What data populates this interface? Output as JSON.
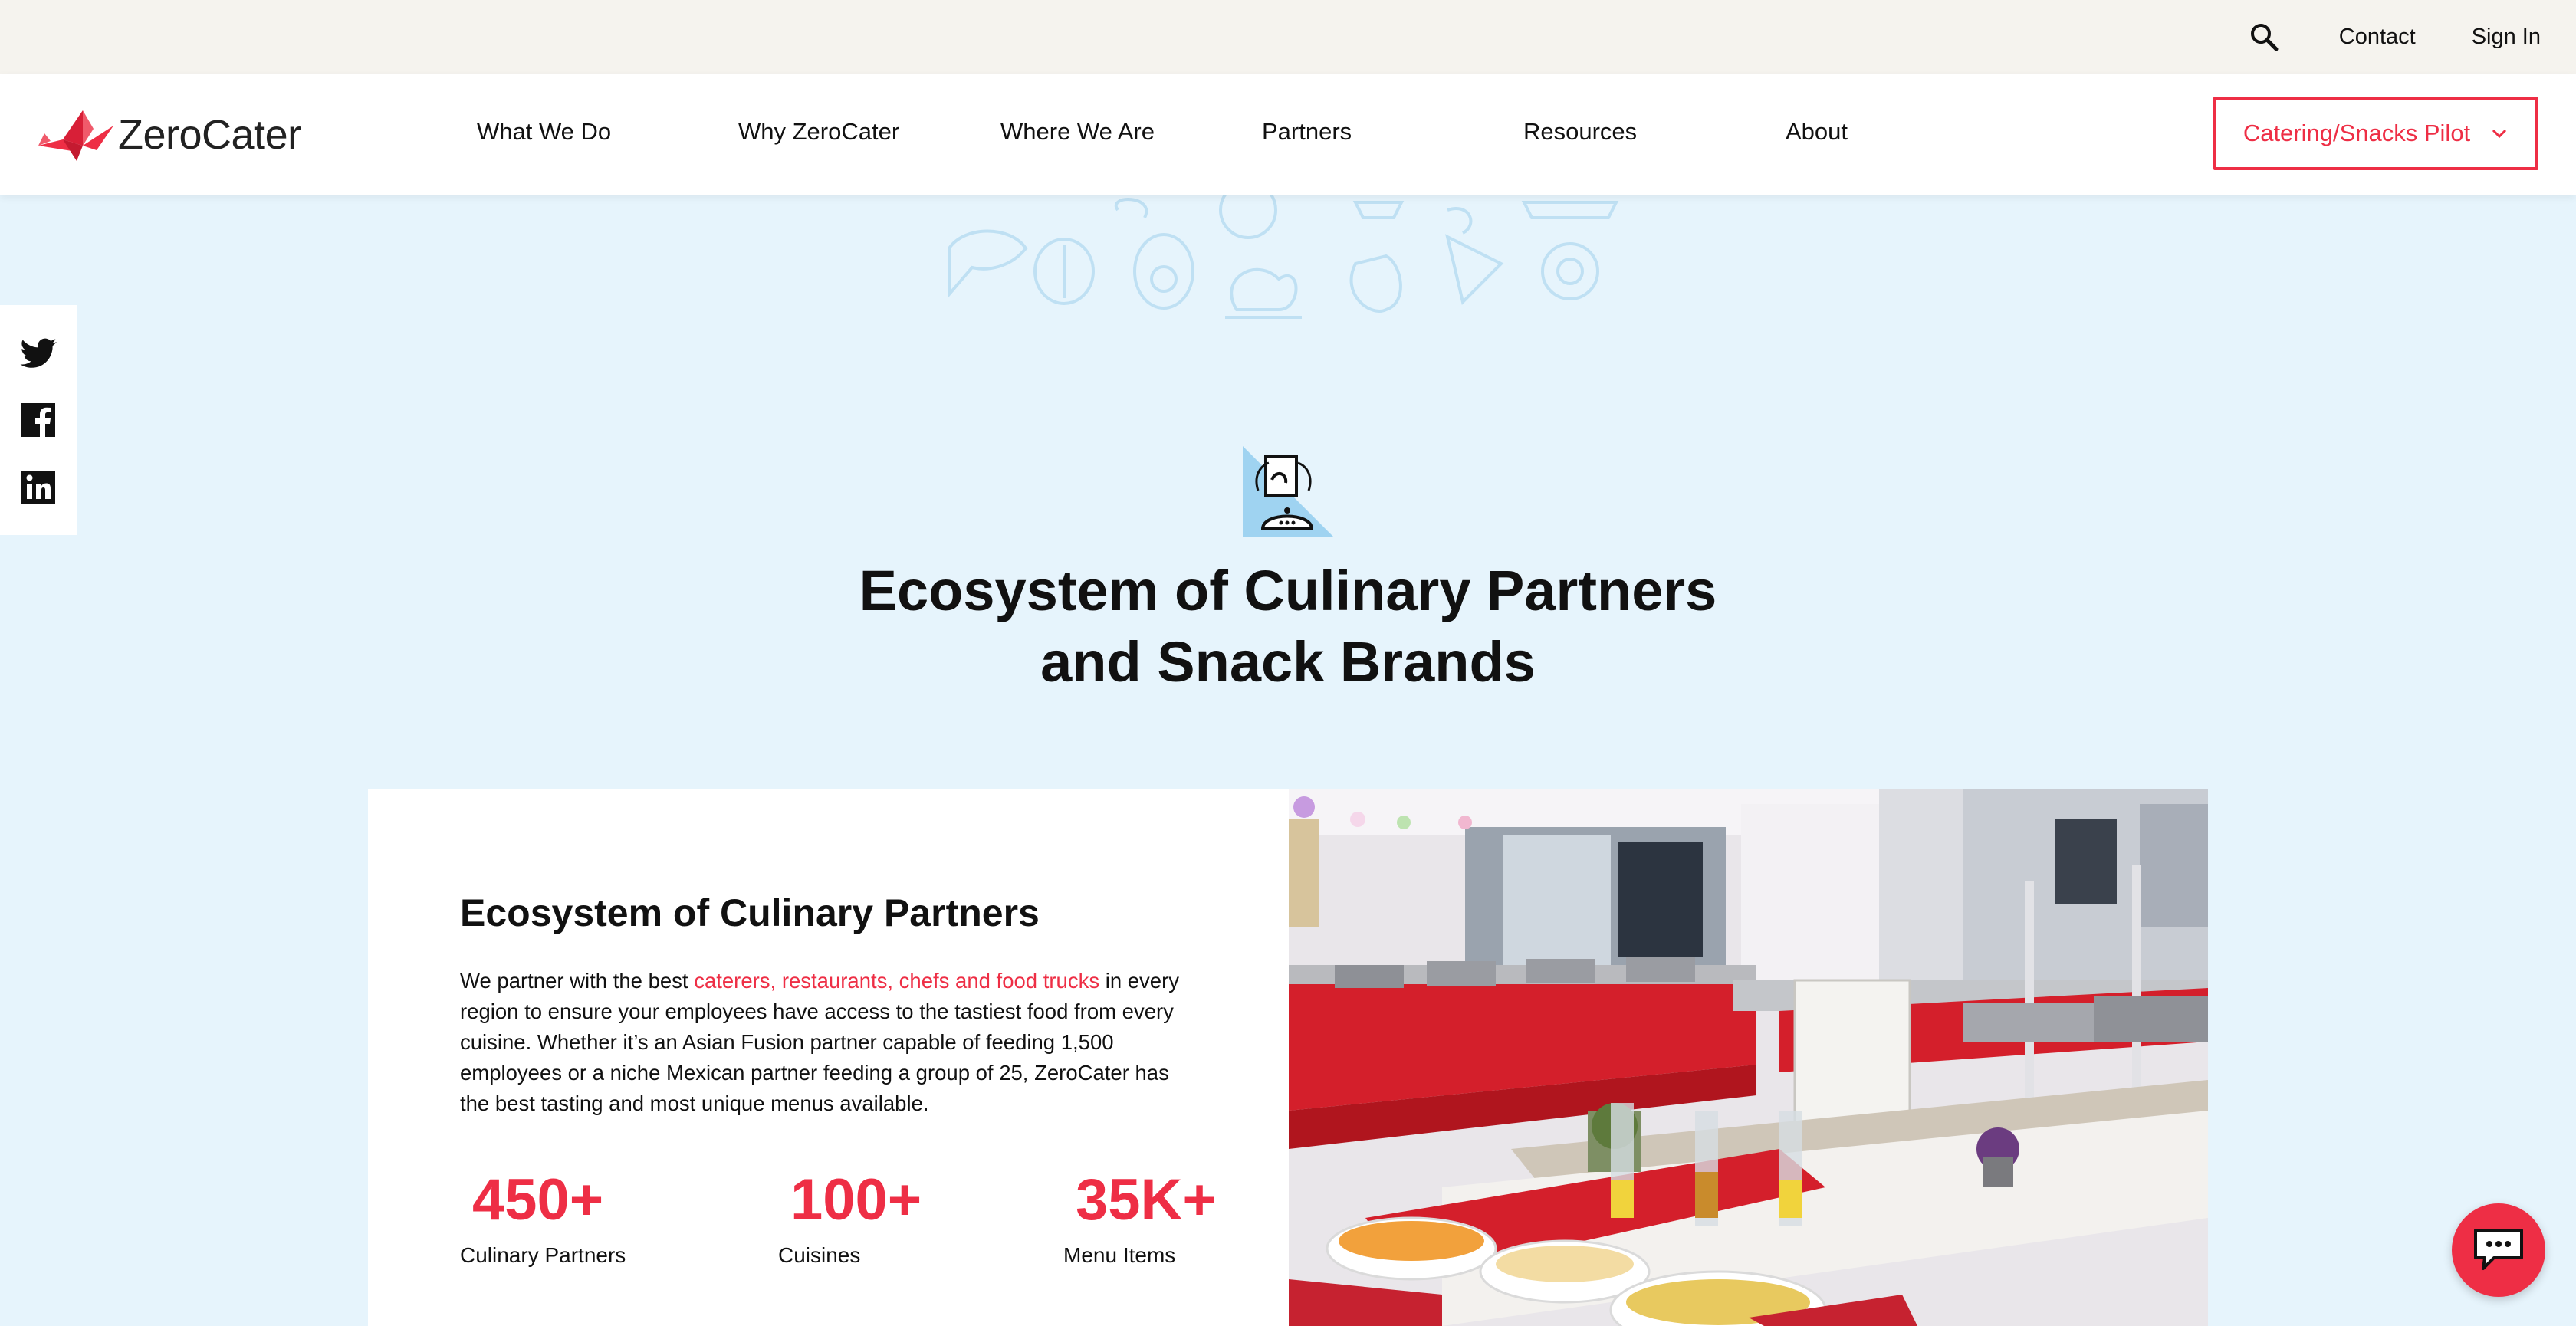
{
  "utility_bar": {
    "contact_label": "Contact",
    "signin_label": "Sign In",
    "search_icon": "search-icon"
  },
  "brand": {
    "name": "ZeroCater",
    "accent_color": "#ee2e45",
    "background_color": "#e6f4fc"
  },
  "nav": {
    "items": [
      {
        "label": "What We Do"
      },
      {
        "label": "Why ZeroCater"
      },
      {
        "label": "Where We Are"
      },
      {
        "label": "Partners"
      },
      {
        "label": "Resources"
      },
      {
        "label": "About"
      }
    ],
    "cta_label": "Catering/Snacks Pilot"
  },
  "social": [
    "twitter-icon",
    "facebook-icon",
    "linkedin-icon"
  ],
  "hero": {
    "title_line1": "Ecosystem of Culinary Partners",
    "title_line2": "and Snack Brands"
  },
  "card": {
    "title": "Ecosystem of Culinary Partners",
    "body_prefix": "We partner with the best ",
    "body_link": "caterers, restaurants, chefs and food trucks",
    "body_suffix": " in every region to ensure your employees have access to the tastiest food from every cuisine. Whether it’s an Asian Fusion partner capable of feeding 1,500 employees or a niche Mexican partner feeding a group of 25, ZeroCater has the best tasting and most unique menus available.",
    "stats": [
      {
        "value": "450+",
        "label": "Culinary Partners"
      },
      {
        "value": "100+",
        "label": "Cuisines"
      },
      {
        "value": "35K+",
        "label": "Menu Items"
      }
    ]
  },
  "chat": {
    "icon": "chat-icon"
  }
}
